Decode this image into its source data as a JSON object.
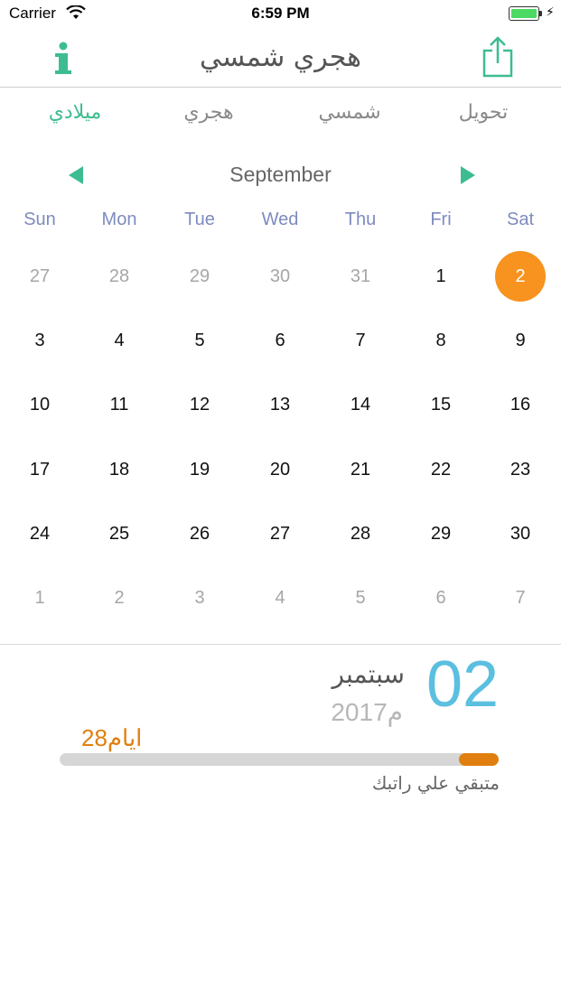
{
  "status_bar": {
    "carrier": "Carrier",
    "time": "6:59 PM",
    "battery_level": 1.0
  },
  "nav": {
    "title": "هجري شمسي",
    "info_icon": "info-icon",
    "share_icon": "share-icon",
    "accent_color": "#3dbd8f"
  },
  "segments": [
    {
      "label": "ميلادي",
      "active": true
    },
    {
      "label": "هجري",
      "active": false
    },
    {
      "label": "شمسي",
      "active": false
    },
    {
      "label": "تحويل",
      "active": false
    }
  ],
  "calendar": {
    "month": "September",
    "weekdays": [
      "Sun",
      "Mon",
      "Tue",
      "Wed",
      "Thu",
      "Fri",
      "Sat"
    ],
    "weeks": [
      [
        {
          "d": "27",
          "o": true
        },
        {
          "d": "28",
          "o": true
        },
        {
          "d": "29",
          "o": true
        },
        {
          "d": "30",
          "o": true
        },
        {
          "d": "31",
          "o": true
        },
        {
          "d": "1",
          "o": false
        },
        {
          "d": "2",
          "o": false,
          "sel": true
        }
      ],
      [
        {
          "d": "3"
        },
        {
          "d": "4"
        },
        {
          "d": "5"
        },
        {
          "d": "6"
        },
        {
          "d": "7"
        },
        {
          "d": "8"
        },
        {
          "d": "9"
        }
      ],
      [
        {
          "d": "10"
        },
        {
          "d": "11"
        },
        {
          "d": "12"
        },
        {
          "d": "13"
        },
        {
          "d": "14"
        },
        {
          "d": "15"
        },
        {
          "d": "16"
        }
      ],
      [
        {
          "d": "17"
        },
        {
          "d": "18"
        },
        {
          "d": "19"
        },
        {
          "d": "20"
        },
        {
          "d": "21"
        },
        {
          "d": "22"
        },
        {
          "d": "23"
        }
      ],
      [
        {
          "d": "24"
        },
        {
          "d": "25"
        },
        {
          "d": "26"
        },
        {
          "d": "27"
        },
        {
          "d": "28"
        },
        {
          "d": "29"
        },
        {
          "d": "30"
        }
      ],
      [
        {
          "d": "1",
          "o": true
        },
        {
          "d": "2",
          "o": true
        },
        {
          "d": "3",
          "o": true
        },
        {
          "d": "4",
          "o": true
        },
        {
          "d": "5",
          "o": true
        },
        {
          "d": "6",
          "o": true
        },
        {
          "d": "7",
          "o": true
        }
      ]
    ],
    "selected_color": "#f7931e"
  },
  "summary": {
    "day": "02",
    "month_name": "سبتمبر",
    "year": "2017م",
    "days_left": "28ايام",
    "progress_remaining_fraction": 0.09,
    "remaining_label": "متبقي علي راتبك",
    "day_color": "#5bbfe0",
    "progress_color": "#e07f0f"
  }
}
